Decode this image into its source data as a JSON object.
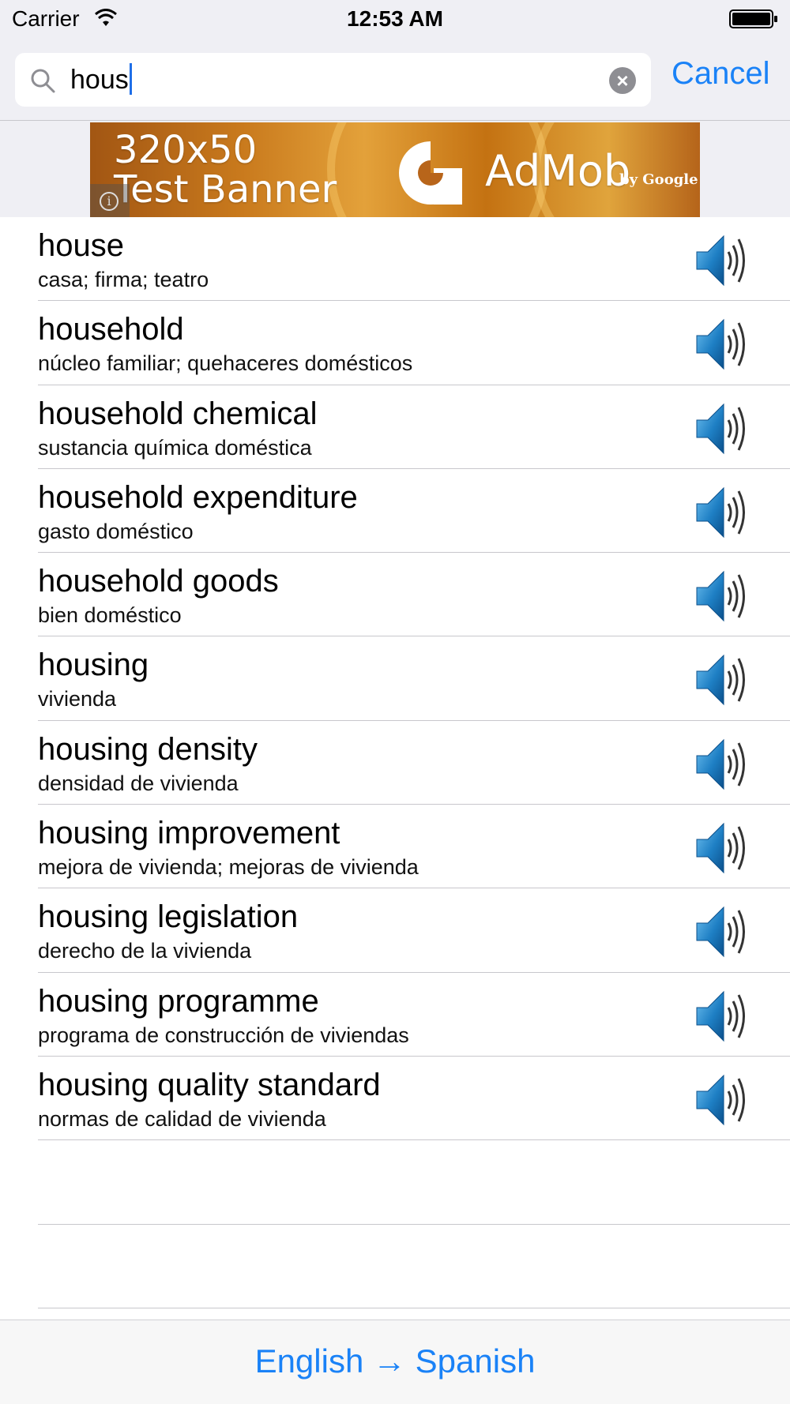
{
  "status_bar": {
    "carrier": "Carrier",
    "time": "12:53 AM"
  },
  "search": {
    "query": "hous",
    "cancel_label": "Cancel"
  },
  "ad": {
    "text": "320x50\nTest Banner",
    "brand": "AdMob",
    "brand_sub": "by Google"
  },
  "results": [
    {
      "term": "house",
      "translation": "casa; firma; teatro"
    },
    {
      "term": "household",
      "translation": "núcleo familiar; quehaceres domésticos"
    },
    {
      "term": "household chemical",
      "translation": "sustancia química doméstica"
    },
    {
      "term": "household expenditure",
      "translation": "gasto doméstico"
    },
    {
      "term": "household goods",
      "translation": "bien doméstico"
    },
    {
      "term": "housing",
      "translation": "vivienda"
    },
    {
      "term": "housing density",
      "translation": "densidad de vivienda"
    },
    {
      "term": "housing improvement",
      "translation": "mejora de vivienda; mejoras de vivienda"
    },
    {
      "term": "housing legislation",
      "translation": "derecho de la vivienda"
    },
    {
      "term": "housing programme",
      "translation": "programa de construcción de viviendas"
    },
    {
      "term": "housing quality standard",
      "translation": "normas de calidad de vivienda"
    }
  ],
  "bottom_bar": {
    "direction_label": "English → Spanish"
  },
  "colors": {
    "accent": "#1a82f7",
    "speaker_blue": "#1e7fc4"
  }
}
